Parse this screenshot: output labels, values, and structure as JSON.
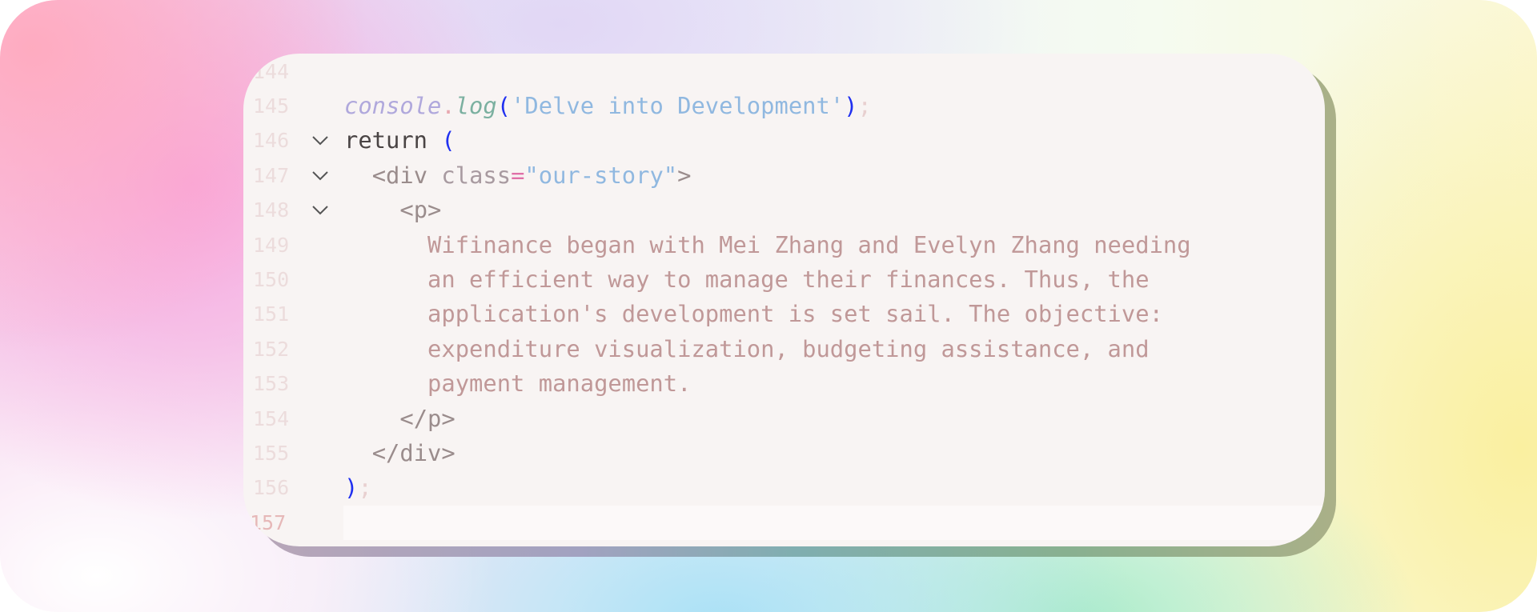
{
  "editor": {
    "lines": [
      {
        "number": "144",
        "foldable": false
      },
      {
        "number": "145",
        "foldable": false,
        "object": "console",
        "dot": ".",
        "method": "log",
        "open": "(",
        "string": "'Delve into Development'",
        "close": ")",
        "semi": ";"
      },
      {
        "number": "146",
        "foldable": true,
        "keyword": "return",
        "open": "("
      },
      {
        "number": "147",
        "foldable": true,
        "tag_open": "<div",
        "attr": "class",
        "eq": "=",
        "value": "\"our-story\"",
        "tag_close": ">"
      },
      {
        "number": "148",
        "foldable": true,
        "tag": "<p>"
      },
      {
        "number": "149",
        "foldable": false,
        "text": "Wifinance began with Mei Zhang and Evelyn Zhang needing"
      },
      {
        "number": "150",
        "foldable": false,
        "text": "an efficient way to manage their finances. Thus, the"
      },
      {
        "number": "151",
        "foldable": false,
        "text": "application's development is set sail. The objective:"
      },
      {
        "number": "152",
        "foldable": false,
        "text": "expenditure visualization, budgeting assistance, and"
      },
      {
        "number": "153",
        "foldable": false,
        "text": "payment management."
      },
      {
        "number": "154",
        "foldable": false,
        "tag": "</p>"
      },
      {
        "number": "155",
        "foldable": false,
        "tag": "</div>"
      },
      {
        "number": "156",
        "foldable": false,
        "close": ")",
        "semi": ";"
      },
      {
        "number": "157",
        "foldable": false,
        "current": true
      }
    ],
    "fold_icon": "chevron-down-icon"
  }
}
